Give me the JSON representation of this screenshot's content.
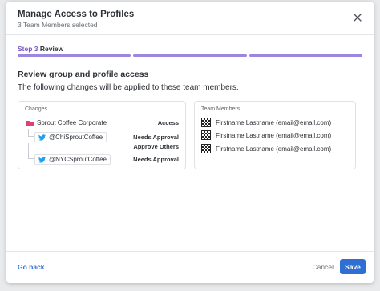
{
  "header": {
    "title": "Manage Access to Profiles",
    "subtitle": "3 Team Members selected"
  },
  "step": {
    "number": "Step 3",
    "name": "Review",
    "progress_segments": 3,
    "progress_color": "#9b86e0"
  },
  "content": {
    "heading": "Review group and profile access",
    "description": "The following changes will be applied to these team members."
  },
  "changes": {
    "title": "Changes",
    "items": [
      {
        "icon": "folder-icon",
        "label": "Sprout Coffee Corporate",
        "access": "Access"
      },
      {
        "icon": "twitter-icon",
        "label": "@ChiSproutCoffee",
        "access": "Needs Approval",
        "access2": "Approve Others"
      },
      {
        "icon": "twitter-icon",
        "label": "@NYCSproutCoffee",
        "access": "Needs Approval"
      }
    ]
  },
  "team_members": {
    "title": "Team Members",
    "items": [
      {
        "label": "Firstname Lastname (email@email.com)"
      },
      {
        "label": "Firstname Lastname (email@email.com)"
      },
      {
        "label": "Firstname Lastname (email@email.com)"
      }
    ]
  },
  "footer": {
    "go_back": "Go back",
    "cancel": "Cancel",
    "save": "Save"
  },
  "colors": {
    "accent": "#2f6fd1",
    "folder": "#e0407a",
    "twitter": "#1da1f2"
  }
}
